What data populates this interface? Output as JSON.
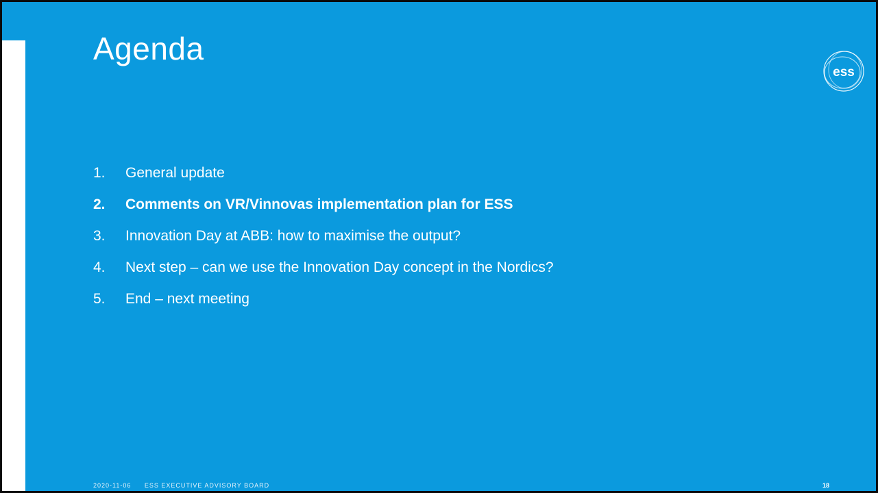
{
  "slide": {
    "title": "Agenda",
    "logo_text": "ess",
    "agenda": [
      {
        "number": "1.",
        "text": "General update",
        "bold": false
      },
      {
        "number": "2.",
        "text": "Comments on VR/Vinnovas implementation plan for ESS",
        "bold": true
      },
      {
        "number": "3.",
        "text": "Innovation Day at ABB: how to maximise the output?",
        "bold": false
      },
      {
        "number": "4.",
        "text": "Next step – can we use the Innovation Day concept in the Nordics?",
        "bold": false
      },
      {
        "number": "5.",
        "text": "End – next meeting",
        "bold": false
      }
    ],
    "footer": {
      "date": "2020-11-06",
      "label": "ESS EXECUTIVE ADVISORY BOARD",
      "page_number": "18"
    }
  },
  "colors": {
    "background": "#0b9ade",
    "text": "#ffffff",
    "accent_bar": "#ffffff"
  }
}
